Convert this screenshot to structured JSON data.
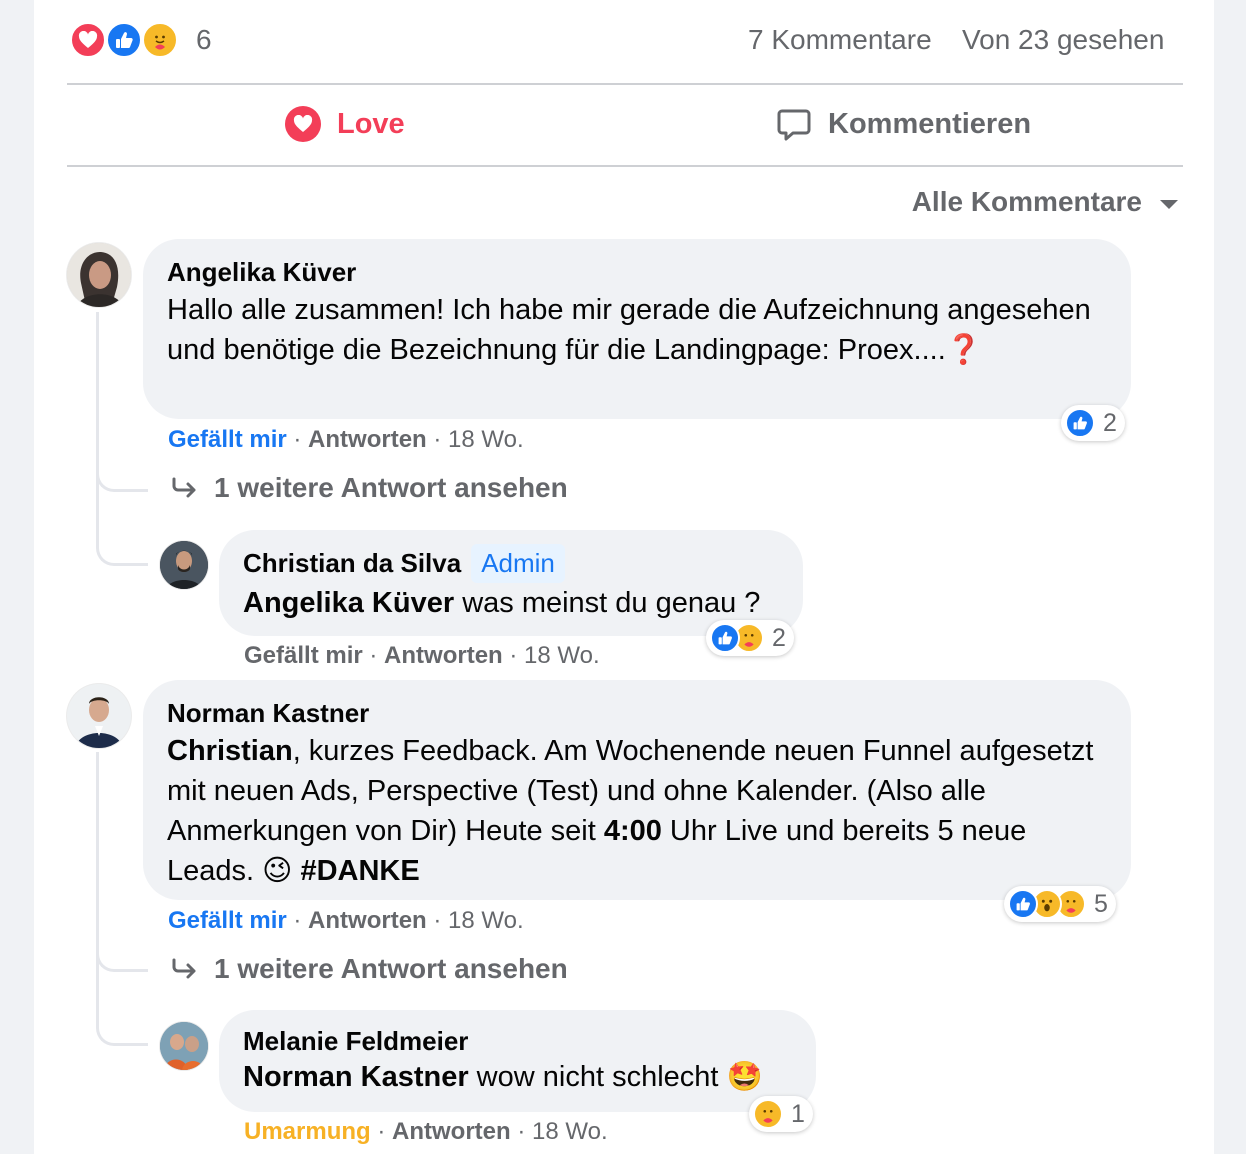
{
  "summary": {
    "reaction_icons": [
      "love-icon",
      "like-icon",
      "care-icon"
    ],
    "reaction_count": "6",
    "comments": "7 Kommentare",
    "seen": "Von 23 gesehen"
  },
  "actions": {
    "love": "Love",
    "comment": "Kommentieren"
  },
  "filter": {
    "label": "Alle Kommentare"
  },
  "colors": {
    "love": "#f33e58",
    "like": "#1877f2",
    "care": "#f7b928",
    "muted": "#65676b",
    "bubble": "#f0f2f5"
  },
  "comments": [
    {
      "author": "Angelika Küver",
      "text": "Hallo alle zusammen! Ich habe mir gerade die Aufzeichnung angesehen und benötige die Bezeichnung für die Landingpage: Proex....",
      "emoji": "❓",
      "like": "Gefällt mir",
      "reply": "Antworten",
      "time": "18 Wo.",
      "reactions": [
        "like-icon"
      ],
      "reaction_count": "2",
      "more_replies": "1 weitere Antwort ansehen",
      "replies": [
        {
          "author": "Christian da Silva",
          "badge": "Admin",
          "mention": "Angelika Küver",
          "text": " was meinst du genau ?",
          "like": "Gefällt mir",
          "reply": "Antworten",
          "time": "18 Wo.",
          "reactions": [
            "like-icon",
            "care-icon"
          ],
          "reaction_count": "2"
        }
      ]
    },
    {
      "author": "Norman Kastner",
      "mention": "Christian",
      "text1": ", kurzes Feedback. Am Wochenende neuen Funnel aufgesetzt mit neuen Ads, Perspective (Test) und ohne Kalender. (Also alle Anmerkungen von Dir) Heute seit ",
      "bold_time": "4:00",
      "text2": " Uhr Live und bereits 5 neue Leads. ",
      "emoji": "😉",
      "hashtag": "#DANKE",
      "like": "Gefällt mir",
      "reply": "Antworten",
      "time": "18 Wo.",
      "reactions": [
        "like-icon",
        "wow-icon",
        "care-icon"
      ],
      "reaction_count": "5",
      "more_replies": "1 weitere Antwort ansehen",
      "replies": [
        {
          "author": "Melanie Feldmeier",
          "mention": "Norman Kastner",
          "text": " wow nicht schlecht",
          "emoji": "🤩",
          "like": "Umarmung",
          "reply": "Antworten",
          "time": "18 Wo.",
          "reactions": [
            "care-icon"
          ],
          "reaction_count": "1"
        }
      ]
    }
  ]
}
